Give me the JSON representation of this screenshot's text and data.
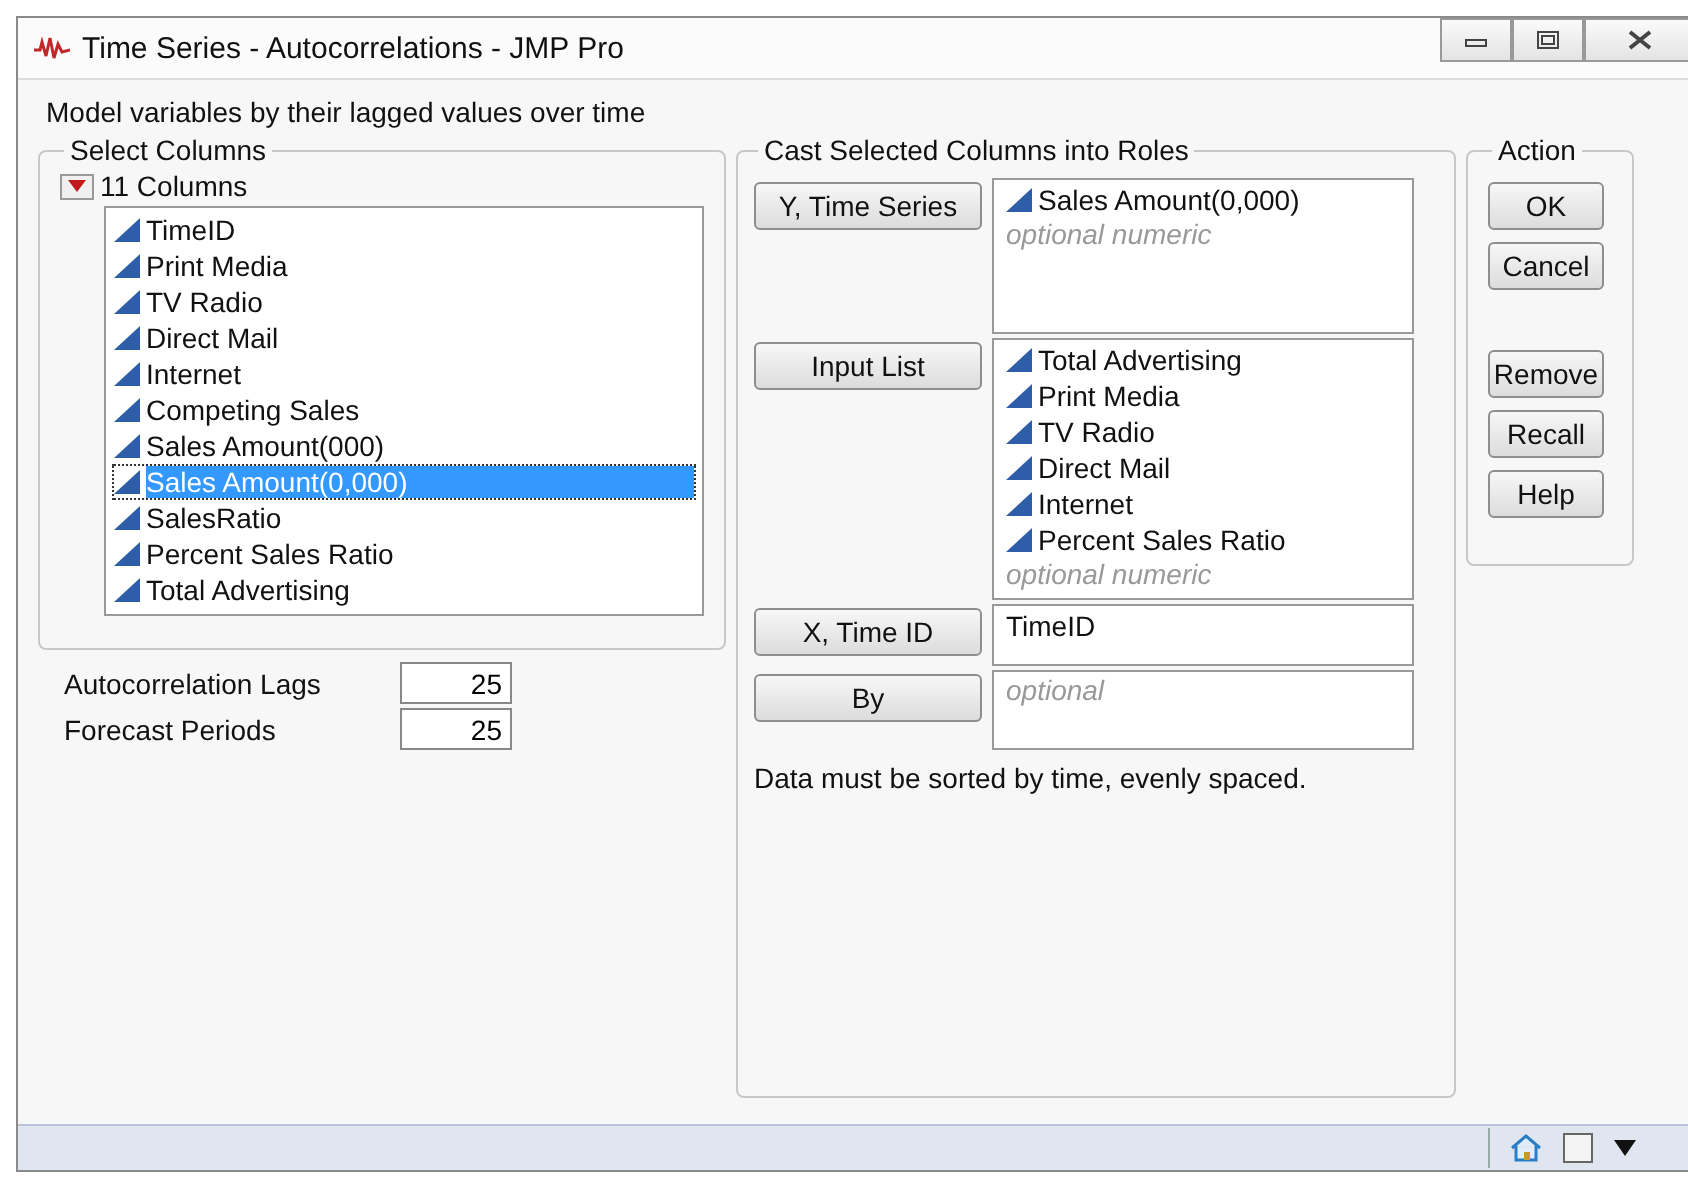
{
  "window": {
    "title": "Time Series - Autocorrelations - JMP Pro"
  },
  "description": "Model variables by their lagged values over time",
  "select_columns": {
    "title": "Select Columns",
    "count_label": "11 Columns",
    "expanded": true,
    "columns": [
      {
        "name": "TimeID",
        "selected": false
      },
      {
        "name": "Print Media",
        "selected": false
      },
      {
        "name": "TV Radio",
        "selected": false
      },
      {
        "name": "Direct Mail",
        "selected": false
      },
      {
        "name": "Internet",
        "selected": false
      },
      {
        "name": "Competing Sales",
        "selected": false
      },
      {
        "name": "Sales Amount(000)",
        "selected": false
      },
      {
        "name": "Sales Amount(0,000)",
        "selected": true
      },
      {
        "name": "SalesRatio",
        "selected": false
      },
      {
        "name": "Percent Sales Ratio",
        "selected": false
      },
      {
        "name": "Total Advertising",
        "selected": false
      }
    ]
  },
  "options": [
    {
      "label": "Autocorrelation Lags",
      "value": "25"
    },
    {
      "label": "Forecast Periods",
      "value": "25"
    }
  ],
  "cast": {
    "title": "Cast Selected Columns into Roles",
    "roles": [
      {
        "button": "Y, Time Series",
        "items": [
          {
            "name": "Sales Amount(0,000)",
            "kind": "continuous"
          }
        ],
        "placeholder": "optional numeric"
      },
      {
        "button": "Input List",
        "items": [
          {
            "name": "Total Advertising",
            "kind": "continuous"
          },
          {
            "name": "Print Media",
            "kind": "continuous"
          },
          {
            "name": "TV Radio",
            "kind": "continuous"
          },
          {
            "name": "Direct Mail",
            "kind": "continuous"
          },
          {
            "name": "Internet",
            "kind": "continuous"
          },
          {
            "name": "Percent Sales Ratio",
            "kind": "continuous"
          }
        ],
        "placeholder": "optional numeric"
      },
      {
        "button": "X, Time ID",
        "items": [
          {
            "name": "TimeID",
            "kind": "plain"
          }
        ]
      },
      {
        "button": "By",
        "placeholder": "optional"
      }
    ],
    "note": "Data must be sorted by time, evenly spaced."
  },
  "action": {
    "title": "Action",
    "groups": [
      [
        "OK",
        "Cancel"
      ],
      [
        "Remove",
        "Recall",
        "Help"
      ]
    ]
  }
}
